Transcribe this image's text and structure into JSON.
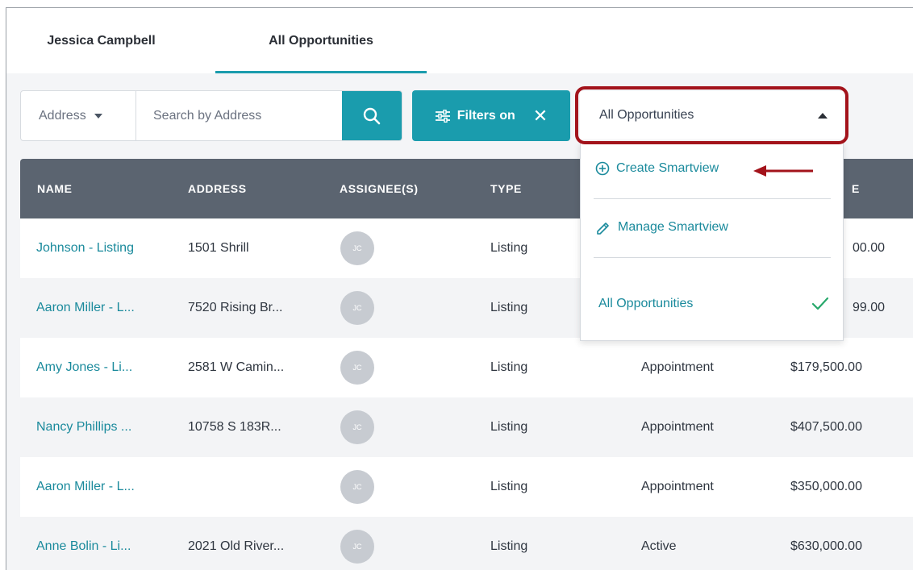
{
  "tabs": [
    {
      "label": "Jessica Campbell",
      "active": false
    },
    {
      "label": "All Opportunities",
      "active": true
    }
  ],
  "search": {
    "field_select": "Address",
    "placeholder": "Search by Address"
  },
  "filters": {
    "label": "Filters on"
  },
  "smartview": {
    "selected": "All Opportunities",
    "menu": {
      "create": "Create Smartview",
      "manage": "Manage Smartview",
      "option": "All Opportunities"
    }
  },
  "table": {
    "columns": [
      "NAME",
      "ADDRESS",
      "ASSIGNEE(S)",
      "TYPE",
      "E"
    ],
    "rows": [
      {
        "name": "Johnson - Listing",
        "address": "1501 Shrill",
        "assignee": "JC",
        "type": "Listing",
        "stage": "",
        "price": "00.00"
      },
      {
        "name": "Aaron Miller - L...",
        "address": "7520 Rising Br...",
        "assignee": "JC",
        "type": "Listing",
        "stage": "",
        "price": "99.00"
      },
      {
        "name": "Amy Jones - Li...",
        "address": "2581 W Camin...",
        "assignee": "JC",
        "type": "Listing",
        "stage": "Appointment",
        "price": "$179,500.00"
      },
      {
        "name": "Nancy Phillips ...",
        "address": "10758 S 183R...",
        "assignee": "JC",
        "type": "Listing",
        "stage": "Appointment",
        "price": "$407,500.00"
      },
      {
        "name": "Aaron Miller - L...",
        "address": "",
        "assignee": "JC",
        "type": "Listing",
        "stage": "Appointment",
        "price": "$350,000.00"
      },
      {
        "name": "Anne Bolin - Li...",
        "address": "2021 Old River...",
        "assignee": "JC",
        "type": "Listing",
        "stage": "Active",
        "price": "$630,000.00"
      }
    ]
  },
  "colors": {
    "accent": "#1a9cad",
    "header": "#5b6470",
    "highlight": "#a3131b"
  }
}
